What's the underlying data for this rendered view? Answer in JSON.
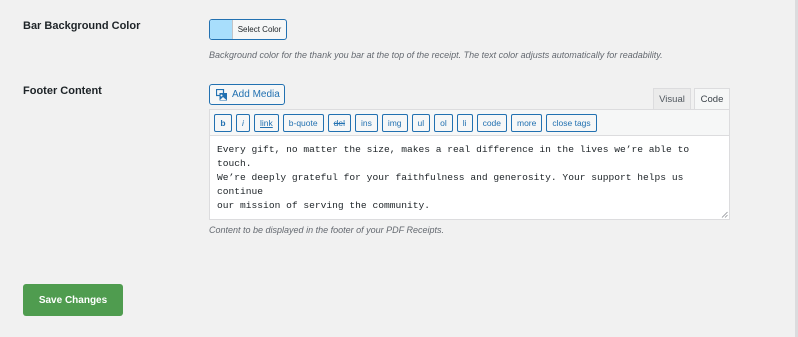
{
  "bar_background": {
    "label": "Bar Background Color",
    "button_label": "Select Color",
    "swatch_color": "#a8defc",
    "description": "Background color for the thank you bar at the top of the receipt. The text color adjusts automatically for readability."
  },
  "footer": {
    "label": "Footer Content",
    "add_media_label": "Add Media",
    "tabs": [
      {
        "label": "Visual",
        "active": false
      },
      {
        "label": "Code",
        "active": true
      }
    ],
    "toolbar": [
      "b",
      "i",
      "link",
      "b-quote",
      "del",
      "ins",
      "img",
      "ul",
      "ol",
      "li",
      "code",
      "more",
      "close tags"
    ],
    "content": "Every gift, no matter the size, makes a real difference in the lives we’re able to touch.\nWe’re deeply grateful for your faithfulness and generosity. Your support helps us continue\nour mission of serving the community.",
    "description": "Content to be displayed in the footer of your PDF Receipts."
  },
  "save_button": {
    "label": "Save Changes",
    "color": "#4f9c4f"
  },
  "colors": {
    "accent": "#2271b1",
    "background": "#f1f1f1"
  }
}
